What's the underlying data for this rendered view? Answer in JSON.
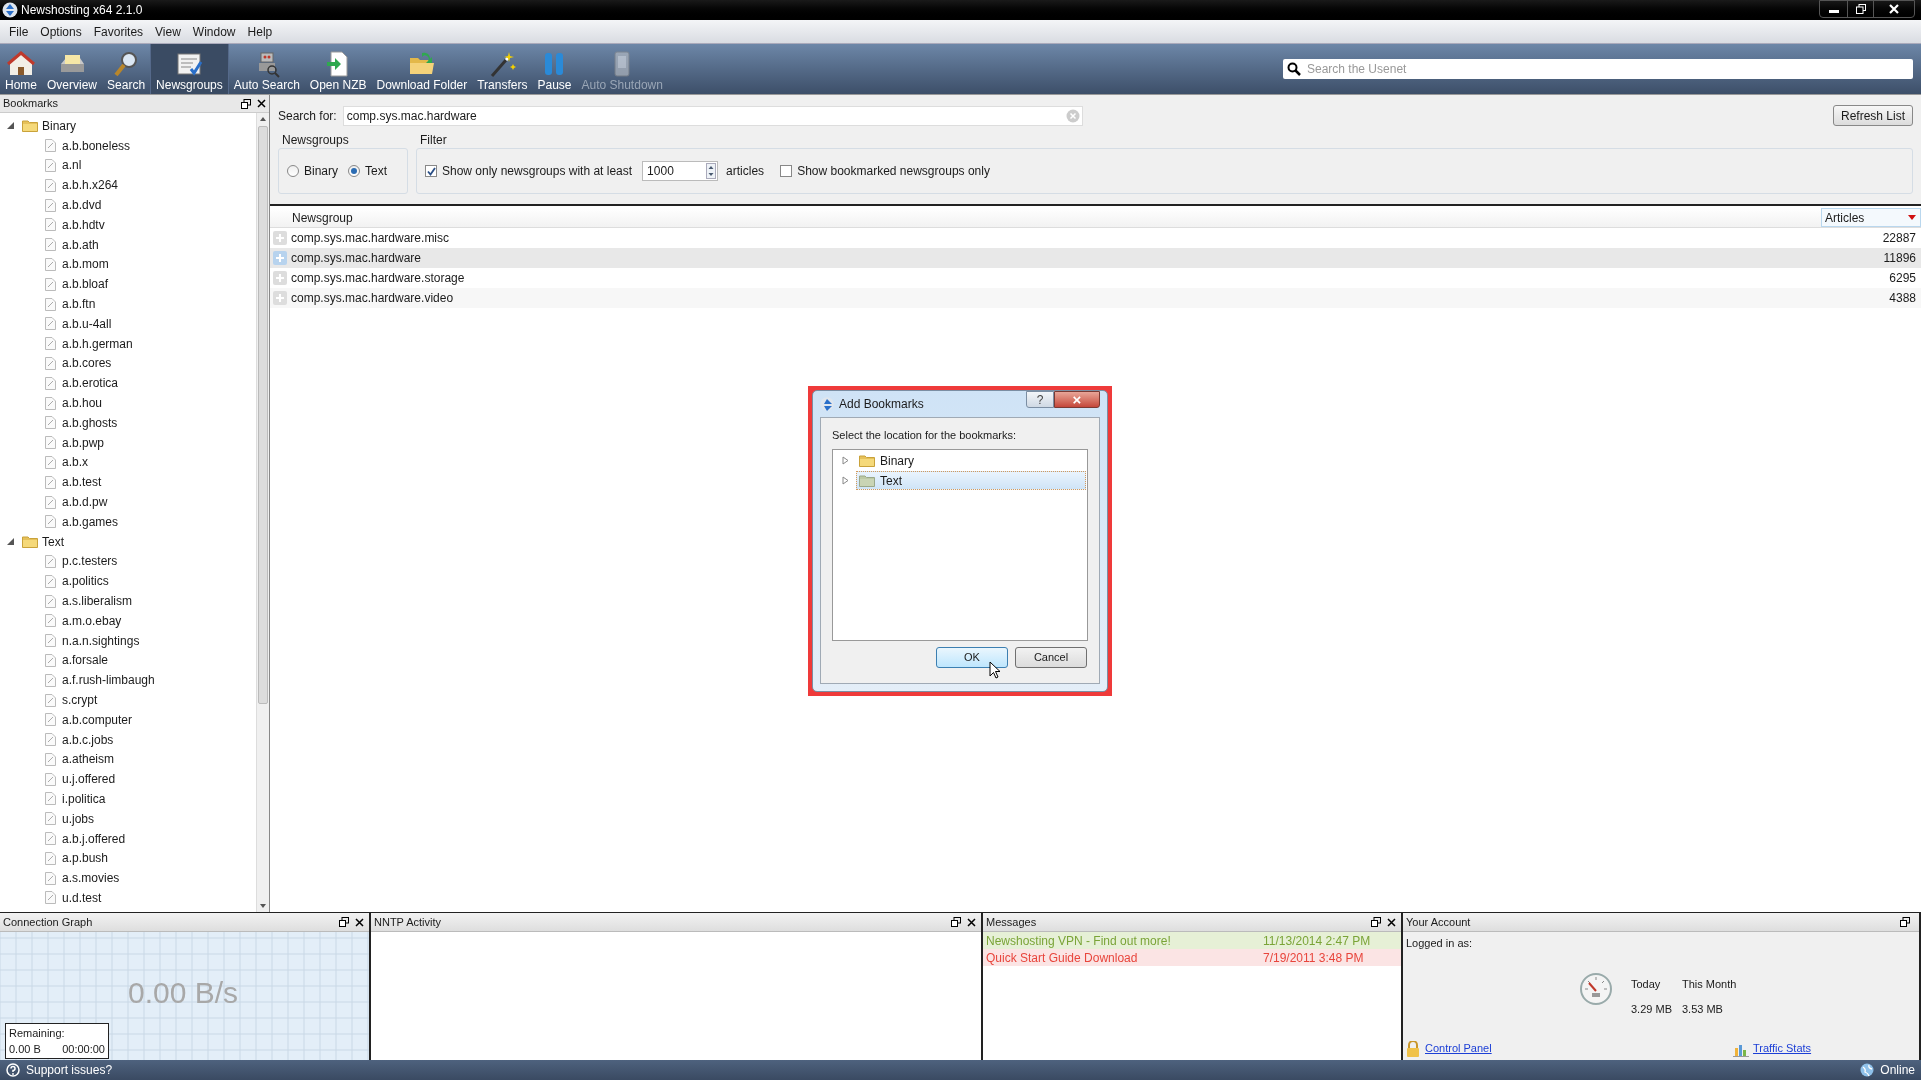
{
  "window": {
    "title": "Newshosting x64 2.1.0"
  },
  "menu": [
    "File",
    "Options",
    "Favorites",
    "View",
    "Window",
    "Help"
  ],
  "toolbar": [
    {
      "label": "Home",
      "selected": false,
      "disabled": false
    },
    {
      "label": "Overview",
      "selected": false,
      "disabled": false
    },
    {
      "label": "Search",
      "selected": false,
      "disabled": false
    },
    {
      "label": "Newsgroups",
      "selected": true,
      "disabled": false
    },
    {
      "label": "Auto Search",
      "selected": false,
      "disabled": false
    },
    {
      "label": "Open NZB",
      "selected": false,
      "disabled": false
    },
    {
      "label": "Download Folder",
      "selected": false,
      "disabled": false
    },
    {
      "label": "Transfers",
      "selected": false,
      "disabled": false
    },
    {
      "label": "Pause",
      "selected": false,
      "disabled": false
    },
    {
      "label": "Auto Shutdown",
      "selected": false,
      "disabled": true
    }
  ],
  "usenet_search": {
    "placeholder": "Search the Usenet"
  },
  "bookmarks": {
    "title": "Bookmarks",
    "tree": [
      {
        "label": "Binary",
        "expanded": true,
        "children": [
          {
            "label": "a.b.boneless"
          },
          {
            "label": "a.nl"
          },
          {
            "label": "a.b.h.x264"
          },
          {
            "label": "a.b.dvd"
          },
          {
            "label": "a.b.hdtv"
          },
          {
            "label": "a.b.ath"
          },
          {
            "label": "a.b.mom"
          },
          {
            "label": "a.b.bloaf"
          },
          {
            "label": "a.b.ftn"
          },
          {
            "label": "a.b.u-4all"
          },
          {
            "label": "a.b.h.german"
          },
          {
            "label": "a.b.cores"
          },
          {
            "label": "a.b.erotica"
          },
          {
            "label": "a.b.hou"
          },
          {
            "label": "a.b.ghosts"
          },
          {
            "label": "a.b.pwp"
          },
          {
            "label": "a.b.x"
          },
          {
            "label": "a.b.test"
          },
          {
            "label": "a.b.d.pw"
          },
          {
            "label": "a.b.games"
          }
        ]
      },
      {
        "label": "Text",
        "expanded": true,
        "children": [
          {
            "label": "p.c.testers"
          },
          {
            "label": "a.politics"
          },
          {
            "label": "a.s.liberalism"
          },
          {
            "label": "a.m.o.ebay"
          },
          {
            "label": "n.a.n.sightings"
          },
          {
            "label": "a.forsale"
          },
          {
            "label": "a.f.rush-limbaugh"
          },
          {
            "label": "s.crypt"
          },
          {
            "label": "a.b.computer"
          },
          {
            "label": "a.b.c.jobs"
          },
          {
            "label": "a.atheism"
          },
          {
            "label": "u.j.offered"
          },
          {
            "label": "i.politica"
          },
          {
            "label": "u.jobs"
          },
          {
            "label": "a.b.j.offered"
          },
          {
            "label": "a.p.bush"
          },
          {
            "label": "a.s.movies"
          },
          {
            "label": "u.d.test"
          }
        ]
      }
    ]
  },
  "search": {
    "label": "Search for:",
    "value": "comp.sys.mac.hardware",
    "refresh_button": "Refresh List"
  },
  "newsgroups_box": {
    "title": "Newsgroups",
    "options": [
      {
        "label": "Binary",
        "selected": false
      },
      {
        "label": "Text",
        "selected": true
      }
    ]
  },
  "filter": {
    "title": "Filter",
    "min_articles": {
      "label": "Show only newsgroups with at least",
      "checked": true,
      "value": "1000",
      "unit": "articles"
    },
    "bookmarked_only": {
      "label": "Show bookmarked newsgroups only",
      "checked": false
    }
  },
  "table": {
    "columns": [
      "Newsgroup",
      "Articles"
    ],
    "rows": [
      {
        "newsgroup": "comp.sys.mac.hardware.misc",
        "articles": "22887",
        "selected": false
      },
      {
        "newsgroup": "comp.sys.mac.hardware",
        "articles": "11896",
        "selected": true
      },
      {
        "newsgroup": "comp.sys.mac.hardware.storage",
        "articles": "6295",
        "selected": false
      },
      {
        "newsgroup": "comp.sys.mac.hardware.video",
        "articles": "4388",
        "selected": false
      }
    ]
  },
  "dialog": {
    "title": "Add Bookmarks",
    "prompt": "Select the location for the bookmarks:",
    "help_button": "?",
    "close_button": "×",
    "folders": [
      {
        "label": "Binary",
        "expanded": false,
        "selected": false
      },
      {
        "label": "Text",
        "expanded": false,
        "selected": true
      }
    ],
    "ok_button": "OK",
    "cancel_button": "Cancel"
  },
  "connection_graph": {
    "title": "Connection Graph",
    "speed": "0.00 B/s",
    "remaining_label": "Remaining:",
    "remaining_size": "0.00 B",
    "remaining_time": "00:00:00"
  },
  "nntp_activity": {
    "title": "NNTP Activity"
  },
  "messages": {
    "title": "Messages",
    "items": [
      {
        "text": "Newshosting VPN - Find out more!",
        "date": "11/13/2014 2:47 PM",
        "kind": "promo"
      },
      {
        "text": "Quick Start Guide Download",
        "date": "7/19/2011 3:48 PM",
        "kind": "alert"
      }
    ]
  },
  "account": {
    "title": "Your Account",
    "logged_in_label": "Logged in as:",
    "today_label": "Today",
    "month_label": "This Month",
    "today_value": "3.29 MB",
    "month_value": "3.53 MB",
    "control_panel_link": "Control Panel",
    "traffic_stats_link": "Traffic Stats"
  },
  "status_bar": {
    "support": "Support issues?",
    "status": "Online"
  }
}
